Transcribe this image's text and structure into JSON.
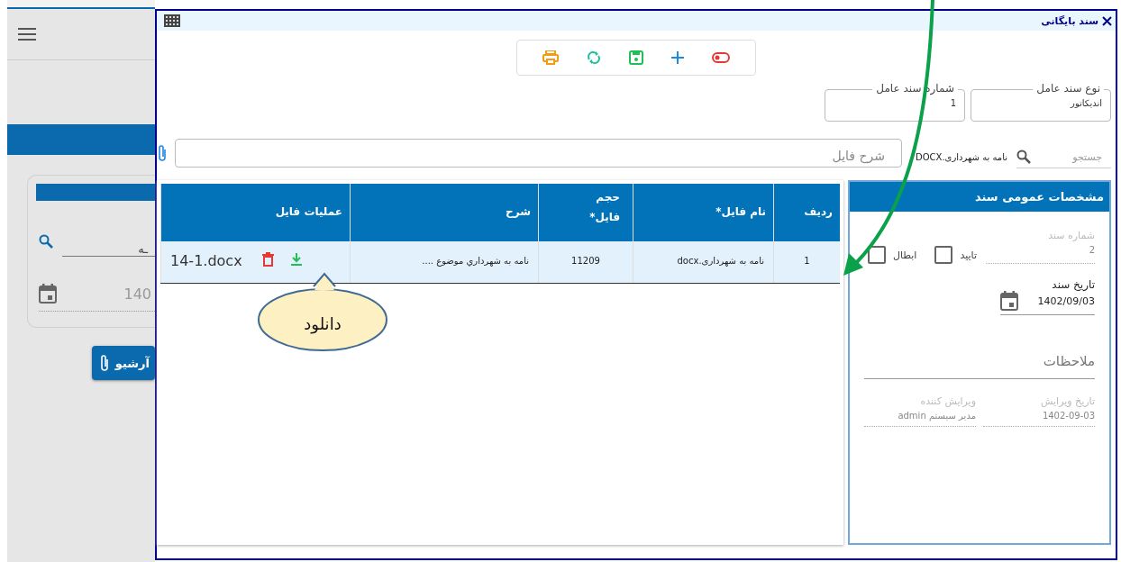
{
  "background": {
    "search_value": "ـه",
    "date_value": "140",
    "archive_button": "آرشیو"
  },
  "dialog": {
    "title": "سند بایگانی",
    "fields": [
      {
        "label": "نوع سند عامل",
        "value": "اندیکاتور"
      },
      {
        "label": "شماره سند عامل",
        "value": "1"
      }
    ],
    "search": {
      "placeholder": "جستجو"
    },
    "file_name": "نامه به شهرداری.DOCX",
    "description": {
      "placeholder": "شرح فایل"
    },
    "table": {
      "columns": [
        "ردیف",
        "نام فایل*",
        "حجم فایل*",
        "شرح",
        "عملیات فایل"
      ],
      "rows": [
        {
          "cells": [
            "1",
            "نامه به شهرداری.docx",
            "11209",
            "نامه به شهرداري موضوع ...."
          ],
          "file": "14-1.docx"
        }
      ]
    },
    "panel": {
      "title": "مشخصات عمومی سند",
      "doc_number": {
        "label": "شماره سند",
        "value": "2"
      },
      "checkboxes": [
        {
          "label": "تایید",
          "checked": false
        },
        {
          "label": "ابطال",
          "checked": false
        }
      ],
      "date": {
        "label": "تاریخ سند",
        "value": "1402/09/03"
      },
      "notes": {
        "placeholder": "ملاحظات"
      },
      "edit_date": {
        "label": "تاریخ ویرایش",
        "value": "1402-09-03"
      },
      "editor": {
        "label": "ویرایش کننده",
        "value": "مدیر سیستم admin"
      }
    }
  },
  "callout": "دانلود"
}
